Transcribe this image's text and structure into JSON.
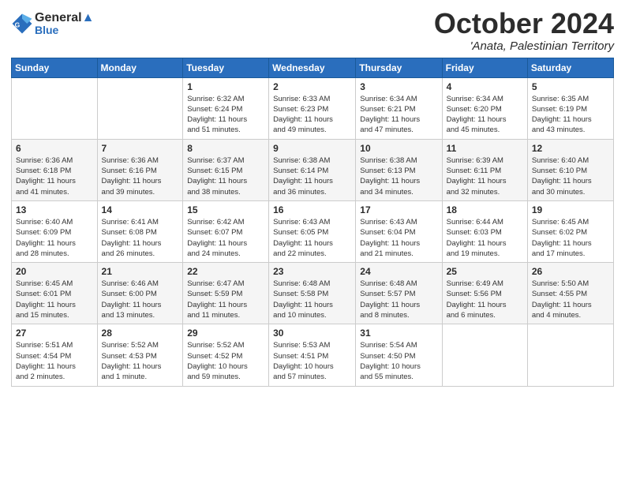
{
  "header": {
    "logo_line1": "General",
    "logo_line2": "Blue",
    "month": "October 2024",
    "location": "'Anata, Palestinian Territory"
  },
  "weekdays": [
    "Sunday",
    "Monday",
    "Tuesday",
    "Wednesday",
    "Thursday",
    "Friday",
    "Saturday"
  ],
  "weeks": [
    [
      {
        "day": "",
        "info": ""
      },
      {
        "day": "",
        "info": ""
      },
      {
        "day": "1",
        "info": "Sunrise: 6:32 AM\nSunset: 6:24 PM\nDaylight: 11 hours\nand 51 minutes."
      },
      {
        "day": "2",
        "info": "Sunrise: 6:33 AM\nSunset: 6:23 PM\nDaylight: 11 hours\nand 49 minutes."
      },
      {
        "day": "3",
        "info": "Sunrise: 6:34 AM\nSunset: 6:21 PM\nDaylight: 11 hours\nand 47 minutes."
      },
      {
        "day": "4",
        "info": "Sunrise: 6:34 AM\nSunset: 6:20 PM\nDaylight: 11 hours\nand 45 minutes."
      },
      {
        "day": "5",
        "info": "Sunrise: 6:35 AM\nSunset: 6:19 PM\nDaylight: 11 hours\nand 43 minutes."
      }
    ],
    [
      {
        "day": "6",
        "info": "Sunrise: 6:36 AM\nSunset: 6:18 PM\nDaylight: 11 hours\nand 41 minutes."
      },
      {
        "day": "7",
        "info": "Sunrise: 6:36 AM\nSunset: 6:16 PM\nDaylight: 11 hours\nand 39 minutes."
      },
      {
        "day": "8",
        "info": "Sunrise: 6:37 AM\nSunset: 6:15 PM\nDaylight: 11 hours\nand 38 minutes."
      },
      {
        "day": "9",
        "info": "Sunrise: 6:38 AM\nSunset: 6:14 PM\nDaylight: 11 hours\nand 36 minutes."
      },
      {
        "day": "10",
        "info": "Sunrise: 6:38 AM\nSunset: 6:13 PM\nDaylight: 11 hours\nand 34 minutes."
      },
      {
        "day": "11",
        "info": "Sunrise: 6:39 AM\nSunset: 6:11 PM\nDaylight: 11 hours\nand 32 minutes."
      },
      {
        "day": "12",
        "info": "Sunrise: 6:40 AM\nSunset: 6:10 PM\nDaylight: 11 hours\nand 30 minutes."
      }
    ],
    [
      {
        "day": "13",
        "info": "Sunrise: 6:40 AM\nSunset: 6:09 PM\nDaylight: 11 hours\nand 28 minutes."
      },
      {
        "day": "14",
        "info": "Sunrise: 6:41 AM\nSunset: 6:08 PM\nDaylight: 11 hours\nand 26 minutes."
      },
      {
        "day": "15",
        "info": "Sunrise: 6:42 AM\nSunset: 6:07 PM\nDaylight: 11 hours\nand 24 minutes."
      },
      {
        "day": "16",
        "info": "Sunrise: 6:43 AM\nSunset: 6:05 PM\nDaylight: 11 hours\nand 22 minutes."
      },
      {
        "day": "17",
        "info": "Sunrise: 6:43 AM\nSunset: 6:04 PM\nDaylight: 11 hours\nand 21 minutes."
      },
      {
        "day": "18",
        "info": "Sunrise: 6:44 AM\nSunset: 6:03 PM\nDaylight: 11 hours\nand 19 minutes."
      },
      {
        "day": "19",
        "info": "Sunrise: 6:45 AM\nSunset: 6:02 PM\nDaylight: 11 hours\nand 17 minutes."
      }
    ],
    [
      {
        "day": "20",
        "info": "Sunrise: 6:45 AM\nSunset: 6:01 PM\nDaylight: 11 hours\nand 15 minutes."
      },
      {
        "day": "21",
        "info": "Sunrise: 6:46 AM\nSunset: 6:00 PM\nDaylight: 11 hours\nand 13 minutes."
      },
      {
        "day": "22",
        "info": "Sunrise: 6:47 AM\nSunset: 5:59 PM\nDaylight: 11 hours\nand 11 minutes."
      },
      {
        "day": "23",
        "info": "Sunrise: 6:48 AM\nSunset: 5:58 PM\nDaylight: 11 hours\nand 10 minutes."
      },
      {
        "day": "24",
        "info": "Sunrise: 6:48 AM\nSunset: 5:57 PM\nDaylight: 11 hours\nand 8 minutes."
      },
      {
        "day": "25",
        "info": "Sunrise: 6:49 AM\nSunset: 5:56 PM\nDaylight: 11 hours\nand 6 minutes."
      },
      {
        "day": "26",
        "info": "Sunrise: 5:50 AM\nSunset: 4:55 PM\nDaylight: 11 hours\nand 4 minutes."
      }
    ],
    [
      {
        "day": "27",
        "info": "Sunrise: 5:51 AM\nSunset: 4:54 PM\nDaylight: 11 hours\nand 2 minutes."
      },
      {
        "day": "28",
        "info": "Sunrise: 5:52 AM\nSunset: 4:53 PM\nDaylight: 11 hours\nand 1 minute."
      },
      {
        "day": "29",
        "info": "Sunrise: 5:52 AM\nSunset: 4:52 PM\nDaylight: 10 hours\nand 59 minutes."
      },
      {
        "day": "30",
        "info": "Sunrise: 5:53 AM\nSunset: 4:51 PM\nDaylight: 10 hours\nand 57 minutes."
      },
      {
        "day": "31",
        "info": "Sunrise: 5:54 AM\nSunset: 4:50 PM\nDaylight: 10 hours\nand 55 minutes."
      },
      {
        "day": "",
        "info": ""
      },
      {
        "day": "",
        "info": ""
      }
    ]
  ]
}
